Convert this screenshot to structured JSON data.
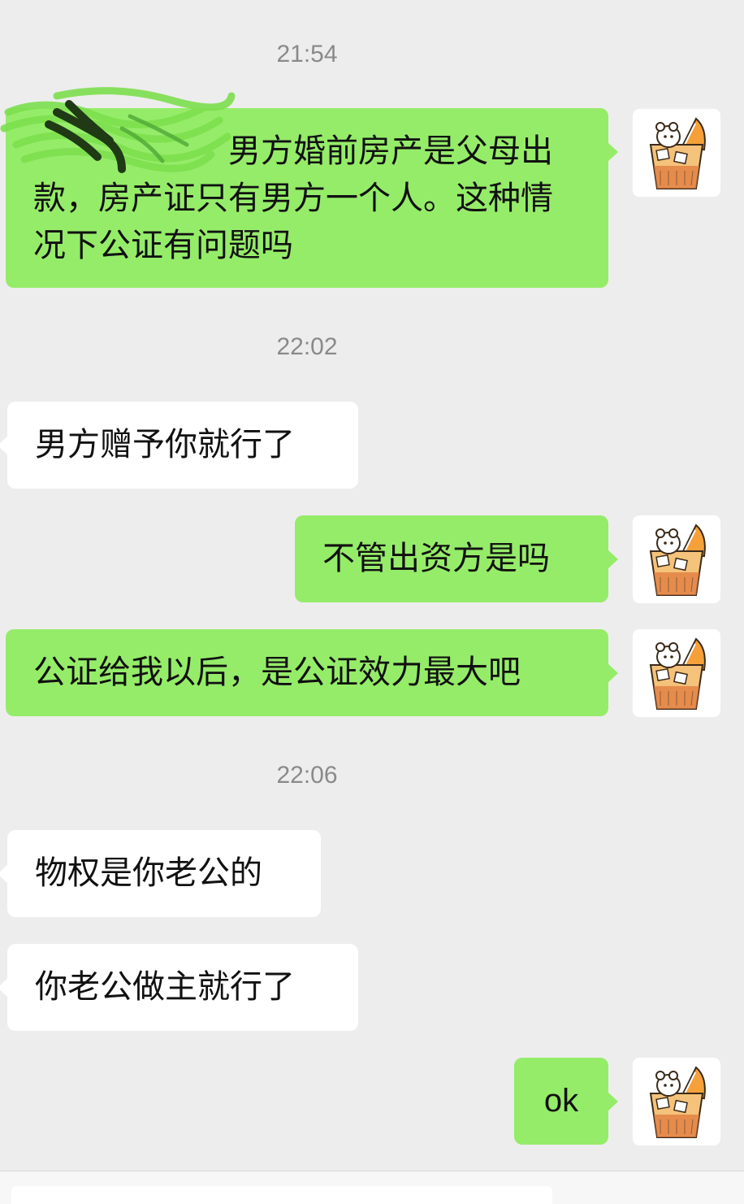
{
  "chat": {
    "messages": [
      {
        "kind": "time",
        "text": "21:54"
      },
      {
        "kind": "out",
        "text": "　　　　　　男方婚前房产是父母出款，房产证只有男方一个人。这种情况下公证有问题吗"
      },
      {
        "kind": "time",
        "text": "22:02"
      },
      {
        "kind": "in",
        "text": "男方赠予你就行了"
      },
      {
        "kind": "out",
        "text": "不管出资方是吗"
      },
      {
        "kind": "out",
        "text": "公证给我以后，是公证效力最大吧"
      },
      {
        "kind": "time",
        "text": "22:06"
      },
      {
        "kind": "in",
        "text": "物权是你老公的"
      },
      {
        "kind": "in",
        "text": "你老公做主就行了"
      },
      {
        "kind": "out",
        "text": "ok"
      }
    ]
  },
  "avatar": {
    "icon": "bear-in-drink-glass-icon"
  },
  "colors": {
    "background": "#ededed",
    "outgoing_bubble": "#95ec69",
    "incoming_bubble": "#ffffff",
    "timestamp_text": "#8a8a8a"
  }
}
